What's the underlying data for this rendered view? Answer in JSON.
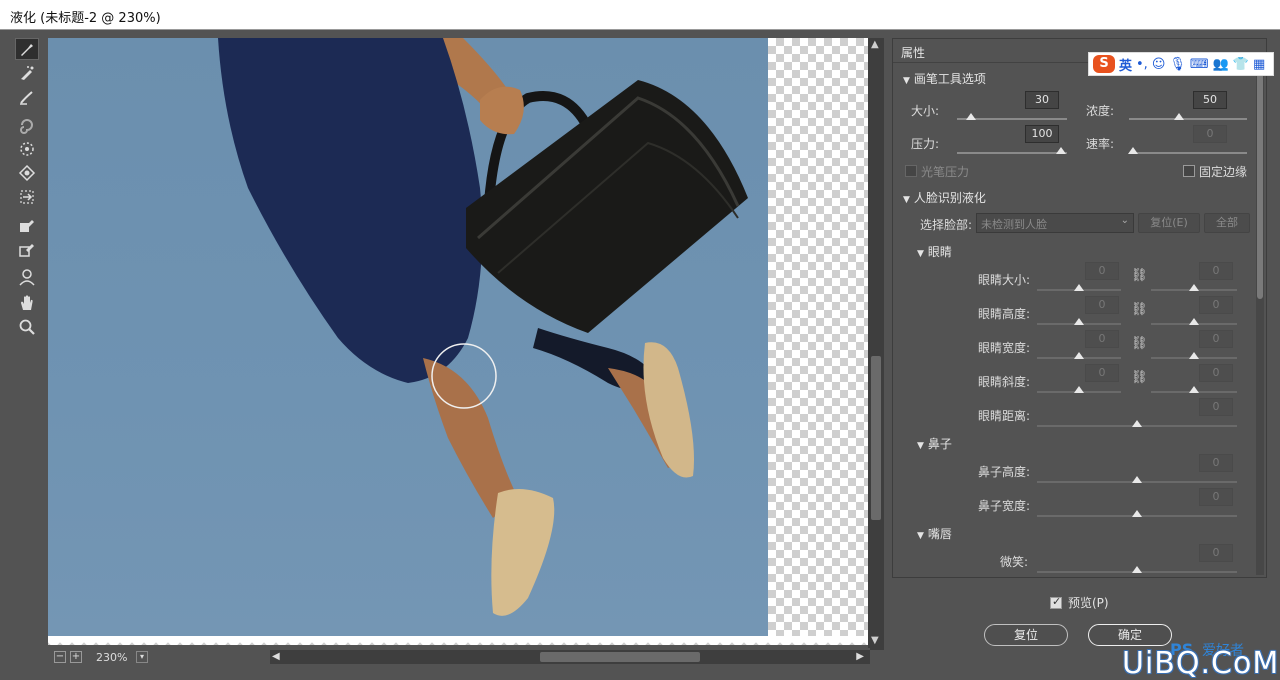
{
  "window": {
    "title": "液化 (未标题-2 @ 230%)"
  },
  "status": {
    "zoom": "230%"
  },
  "panel": {
    "header": "属性",
    "brush": {
      "title": "画笔工具选项",
      "size_label": "大小:",
      "size_value": "30",
      "density_label": "浓度:",
      "density_value": "50",
      "pressure_label": "压力:",
      "pressure_value": "100",
      "rate_label": "速率:",
      "rate_value": "0",
      "stylus_label": "光笔压力",
      "pin_edges_label": "固定边缘"
    },
    "face": {
      "title": "人脸识别液化",
      "select_label": "选择脸部:",
      "select_value": "未检测到人脸",
      "reset_label": "复位(E)",
      "all_label": "全部",
      "eyes": {
        "title": "眼睛",
        "size": "眼睛大小:",
        "height": "眼睛高度:",
        "width": "眼睛宽度:",
        "tilt": "眼睛斜度:",
        "distance": "眼睛距离:",
        "value": "0"
      },
      "nose": {
        "title": "鼻子",
        "height": "鼻子高度:",
        "width": "鼻子宽度:",
        "value": "0"
      },
      "mouth": {
        "title": "嘴唇",
        "smile": "微笑:",
        "value": "0"
      }
    }
  },
  "footer": {
    "preview_label": "预览(P)",
    "reset_button": "复位",
    "ok_button": "确定"
  },
  "ime": {
    "logo": "S",
    "mode": "英",
    "punct": "•,"
  },
  "watermark": {
    "ps": "PS",
    "cn": "爱好者",
    "site": "UiBQ.CoM"
  }
}
